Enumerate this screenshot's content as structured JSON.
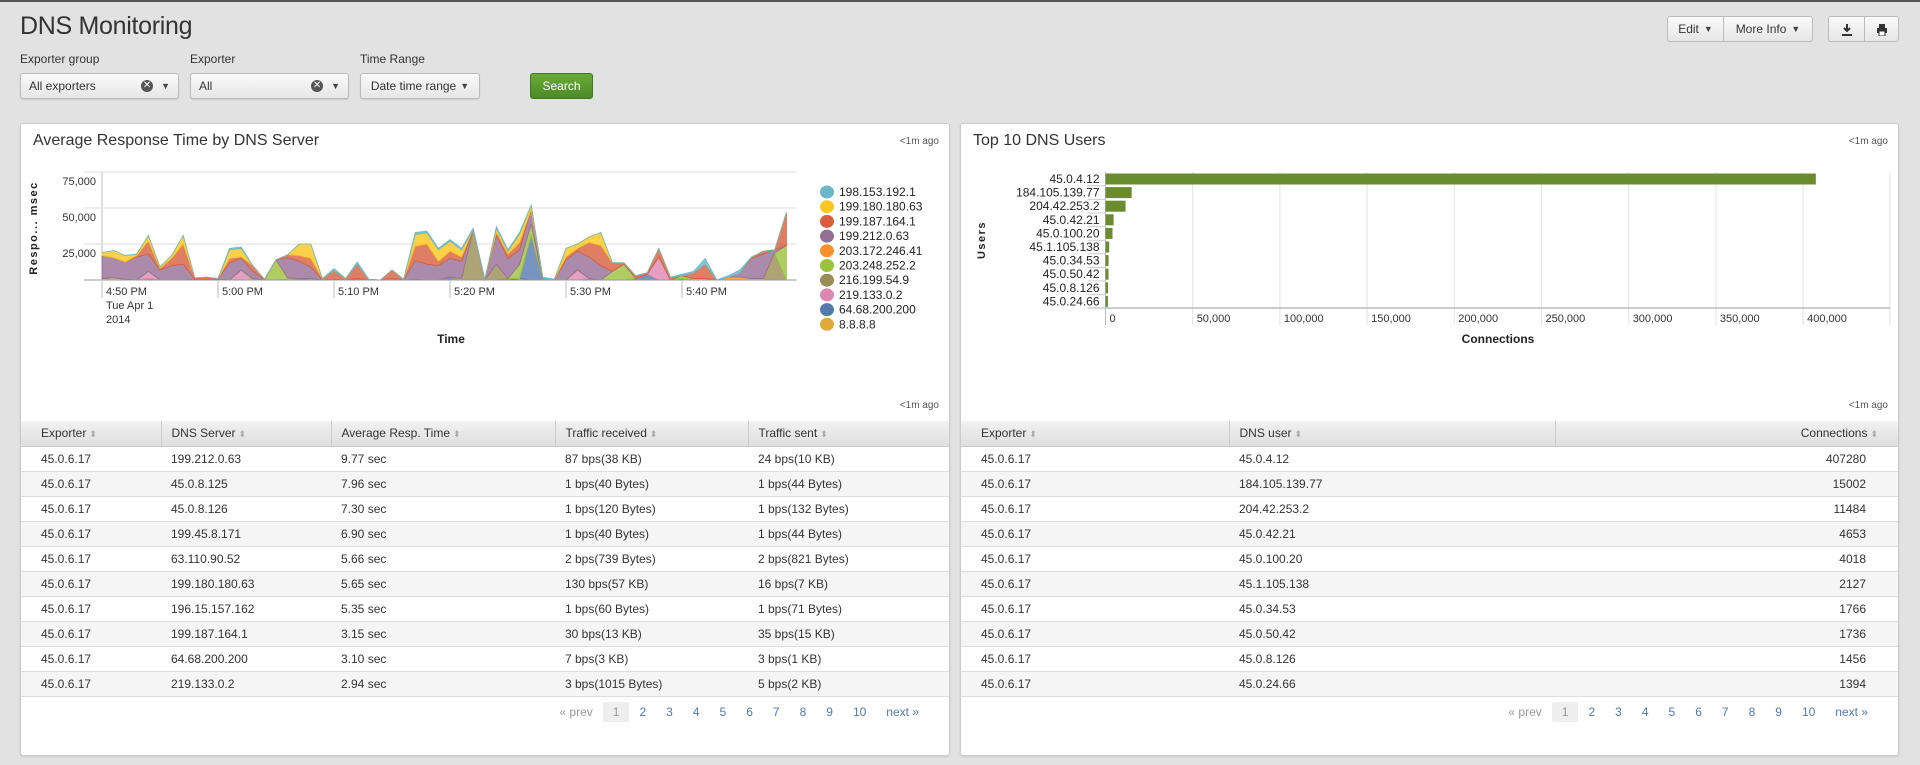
{
  "header": {
    "title": "DNS Monitoring",
    "edit_label": "Edit",
    "more_info_label": "More Info",
    "download_icon": "download-icon",
    "print_icon": "print-icon"
  },
  "filters": {
    "exporter_group": {
      "label": "Exporter group",
      "value": "All exporters"
    },
    "exporter": {
      "label": "Exporter",
      "value": "All"
    },
    "time_range": {
      "label": "Time Range",
      "value": "Date time range"
    },
    "search_label": "Search"
  },
  "left_panel": {
    "title": "Average Response Time by DNS Server",
    "updated": "<1m ago",
    "table_updated": "<1m ago",
    "columns": [
      "Exporter",
      "DNS Server",
      "Average Resp. Time",
      "Traffic received",
      "Traffic sent"
    ],
    "rows": [
      [
        "45.0.6.17",
        "199.212.0.63",
        "9.77 sec",
        "87 bps(38 KB)",
        "24 bps(10 KB)"
      ],
      [
        "45.0.6.17",
        "45.0.8.125",
        "7.96 sec",
        "1 bps(40 Bytes)",
        "1 bps(44 Bytes)"
      ],
      [
        "45.0.6.17",
        "45.0.8.126",
        "7.30 sec",
        "1 bps(120 Bytes)",
        "1 bps(132 Bytes)"
      ],
      [
        "45.0.6.17",
        "199.45.8.171",
        "6.90 sec",
        "1 bps(40 Bytes)",
        "1 bps(44 Bytes)"
      ],
      [
        "45.0.6.17",
        "63.110.90.52",
        "5.66 sec",
        "2 bps(739 Bytes)",
        "2 bps(821 Bytes)"
      ],
      [
        "45.0.6.17",
        "199.180.180.63",
        "5.65 sec",
        "130 bps(57 KB)",
        "16 bps(7 KB)"
      ],
      [
        "45.0.6.17",
        "196.15.157.162",
        "5.35 sec",
        "1 bps(60 Bytes)",
        "1 bps(71 Bytes)"
      ],
      [
        "45.0.6.17",
        "199.187.164.1",
        "3.15 sec",
        "30 bps(13 KB)",
        "35 bps(15 KB)"
      ],
      [
        "45.0.6.17",
        "64.68.200.200",
        "3.10 sec",
        "7 bps(3 KB)",
        "3 bps(1 KB)"
      ],
      [
        "45.0.6.17",
        "219.133.0.2",
        "2.94 sec",
        "3 bps(1015 Bytes)",
        "5 bps(2 KB)"
      ]
    ],
    "pager": {
      "prev": "« prev",
      "pages": [
        "1",
        "2",
        "3",
        "4",
        "5",
        "6",
        "7",
        "8",
        "9",
        "10"
      ],
      "current": "1",
      "next": "next »"
    }
  },
  "right_panel": {
    "title": "Top 10 DNS Users",
    "updated": "<1m ago",
    "table_updated": "<1m ago",
    "columns": [
      "Exporter",
      "DNS user",
      "Connections"
    ],
    "rows": [
      [
        "45.0.6.17",
        "45.0.4.12",
        "407280"
      ],
      [
        "45.0.6.17",
        "184.105.139.77",
        "15002"
      ],
      [
        "45.0.6.17",
        "204.42.253.2",
        "11484"
      ],
      [
        "45.0.6.17",
        "45.0.42.21",
        "4653"
      ],
      [
        "45.0.6.17",
        "45.0.100.20",
        "4018"
      ],
      [
        "45.0.6.17",
        "45.1.105.138",
        "2127"
      ],
      [
        "45.0.6.17",
        "45.0.34.53",
        "1766"
      ],
      [
        "45.0.6.17",
        "45.0.50.42",
        "1736"
      ],
      [
        "45.0.6.17",
        "45.0.8.126",
        "1456"
      ],
      [
        "45.0.6.17",
        "45.0.24.66",
        "1394"
      ]
    ],
    "pager": {
      "prev": "« prev",
      "pages": [
        "1",
        "2",
        "3",
        "4",
        "5",
        "6",
        "7",
        "8",
        "9",
        "10"
      ],
      "current": "1",
      "next": "next »"
    }
  },
  "chart_data": [
    {
      "type": "area",
      "stacked": true,
      "xlabel": "Time",
      "ylabel": "Respo... msec",
      "ylim": [
        0,
        75000
      ],
      "yticks": [
        "25,000",
        "50,000",
        "75,000"
      ],
      "ytick_values": [
        25000,
        50000,
        75000
      ],
      "xticks": [
        "4:50 PM",
        "5:00 PM",
        "5:10 PM",
        "5:20 PM",
        "5:30 PM",
        "5:40 PM"
      ],
      "xtick_minutes": [
        0,
        10,
        20,
        30,
        40,
        50
      ],
      "xtick_sublabel": [
        "Tue Apr 1",
        "2014"
      ],
      "x": [
        "4:50 PM",
        "4:51 PM",
        "4:52 PM",
        "4:53 PM",
        "4:54 PM",
        "4:55 PM",
        "4:56 PM",
        "4:57 PM",
        "4:58 PM",
        "4:59 PM",
        "5:00 PM",
        "5:01 PM",
        "5:02 PM",
        "5:03 PM",
        "5:04 PM",
        "5:05 PM",
        "5:06 PM",
        "5:07 PM",
        "5:08 PM",
        "5:09 PM",
        "5:10 PM",
        "5:11 PM",
        "5:12 PM",
        "5:13 PM",
        "5:14 PM",
        "5:15 PM",
        "5:16 PM",
        "5:17 PM",
        "5:18 PM",
        "5:19 PM",
        "5:20 PM",
        "5:21 PM",
        "5:22 PM",
        "5:23 PM",
        "5:24 PM",
        "5:25 PM",
        "5:26 PM",
        "5:27 PM",
        "5:28 PM",
        "5:29 PM",
        "5:30 PM",
        "5:31 PM",
        "5:32 PM",
        "5:33 PM",
        "5:34 PM",
        "5:35 PM",
        "5:36 PM",
        "5:37 PM",
        "5:38 PM",
        "5:39 PM",
        "5:40 PM",
        "5:41 PM",
        "5:42 PM",
        "5:43 PM",
        "5:44 PM",
        "5:45 PM",
        "5:46 PM",
        "5:47 PM",
        "5:48 PM",
        "5:49 PM"
      ],
      "grid": true,
      "legend": "right",
      "series": [
        {
          "name": "198.153.192.1",
          "color": "#6ab7c7",
          "values": [
            0,
            0,
            0,
            0,
            0,
            0,
            0,
            0,
            0,
            0,
            0,
            1000,
            1000,
            0,
            0,
            0,
            0,
            0,
            0,
            0,
            1500,
            0,
            1500,
            0,
            0,
            0,
            0,
            1500,
            1000,
            1000,
            1000,
            1000,
            1000,
            0,
            1000,
            1000,
            1000,
            0,
            1000,
            0,
            0,
            0,
            0,
            0,
            0,
            0,
            0,
            0,
            0,
            0,
            1000,
            1000,
            4000,
            0,
            1000,
            2000,
            0,
            0,
            0,
            0
          ]
        },
        {
          "name": "199.180.180.63",
          "color": "#fac61d",
          "values": [
            2000,
            5000,
            4500,
            1000,
            4000,
            1000,
            2000,
            6000,
            0,
            0,
            0,
            6000,
            6000,
            0,
            0,
            0,
            0,
            8000,
            10000,
            0,
            0,
            0,
            0,
            0,
            0,
            0,
            0,
            8000,
            8000,
            8000,
            7000,
            5000,
            0,
            0,
            3000,
            2000,
            6000,
            3000,
            0,
            0,
            6000,
            3000,
            4000,
            9000,
            0,
            0,
            0,
            0,
            0,
            0,
            0,
            0,
            0,
            0,
            0,
            0,
            0,
            0,
            0,
            0
          ]
        },
        {
          "name": "199.187.164.1",
          "color": "#d85e3d",
          "values": [
            0,
            0,
            0,
            1000,
            9000,
            1000,
            5000,
            14000,
            1000,
            1500,
            500,
            3000,
            1000,
            4000,
            500,
            0,
            2000,
            4000,
            6000,
            1000,
            6000,
            1000,
            10000,
            500,
            0,
            6000,
            500,
            10000,
            14000,
            3000,
            5000,
            3000,
            0,
            500,
            2000,
            3000,
            5000,
            0,
            1000,
            500,
            2000,
            2000,
            10000,
            14000,
            6000,
            1000,
            2000,
            1000,
            6000,
            2000,
            0,
            4000,
            10000,
            0,
            0,
            0,
            1000,
            2000,
            0,
            23000
          ]
        },
        {
          "name": "199.212.0.63",
          "color": "#956e96",
          "values": [
            16000,
            14000,
            12000,
            16000,
            12000,
            7000,
            10000,
            11000,
            0,
            0,
            0,
            12000,
            8000,
            5000,
            0,
            0,
            14000,
            12000,
            8000,
            0,
            0,
            0,
            0,
            0,
            0,
            0,
            0,
            13000,
            11000,
            10000,
            13000,
            12000,
            0,
            0,
            20000,
            14000,
            10000,
            10000,
            0,
            0,
            14000,
            13000,
            15000,
            10000,
            0,
            0,
            0,
            0,
            0,
            0,
            0,
            0,
            0,
            0,
            0,
            3000,
            14000,
            17000,
            2000,
            0
          ]
        },
        {
          "name": "203.172.246.41",
          "color": "#f7912c",
          "values": [
            0,
            0,
            0,
            0,
            0,
            0,
            0,
            0,
            0,
            0,
            0,
            0,
            0,
            0,
            0,
            0,
            0,
            0,
            0,
            0,
            0,
            0,
            0,
            0,
            0,
            0,
            0,
            0,
            0,
            0,
            0,
            0,
            0,
            0,
            0,
            0,
            0,
            0,
            0,
            0,
            0,
            0,
            0,
            0,
            0,
            0,
            0,
            0,
            0,
            0,
            0,
            0,
            0,
            0,
            2000,
            2000,
            1000,
            1000,
            0,
            0
          ]
        },
        {
          "name": "203.248.252.2",
          "color": "#9ac23c",
          "values": [
            0,
            0,
            0,
            0,
            0,
            0,
            0,
            0,
            0,
            0,
            0,
            0,
            0,
            1000,
            0,
            14000,
            1000,
            0,
            0,
            0,
            0,
            0,
            0,
            0,
            0,
            1000,
            0,
            500,
            0,
            0,
            0,
            1000,
            0,
            0,
            0,
            0,
            10000,
            8000,
            0,
            0,
            0,
            0,
            0,
            0,
            6000,
            11000,
            0,
            0,
            0,
            0,
            2000,
            1000,
            1000,
            0,
            0,
            0,
            0,
            0,
            1000,
            24000
          ]
        },
        {
          "name": "216.199.54.9",
          "color": "#998c55",
          "values": [
            0,
            0,
            0,
            0,
            0,
            0,
            0,
            0,
            0,
            0,
            0,
            0,
            0,
            0,
            0,
            0,
            0,
            0,
            1000,
            0,
            0,
            0,
            0,
            0,
            0,
            0,
            0,
            0,
            0,
            0,
            0,
            0,
            35000,
            0,
            11000,
            0,
            0,
            0,
            0,
            0,
            0,
            0,
            0,
            0,
            0,
            0,
            0,
            0,
            0,
            0,
            0,
            0,
            0,
            0,
            0,
            0,
            0,
            0,
            18000,
            0
          ]
        },
        {
          "name": "219.133.0.2",
          "color": "#dd87b3",
          "values": [
            0,
            0,
            0,
            0,
            5000,
            0,
            0,
            0,
            0,
            0,
            0,
            0,
            7000,
            0,
            0,
            0,
            0,
            0,
            0,
            0,
            0,
            0,
            0,
            0,
            0,
            0,
            0,
            0,
            0,
            0,
            0,
            0,
            0,
            0,
            0,
            0,
            0,
            0,
            0,
            0,
            0,
            7000,
            0,
            0,
            0,
            0,
            0,
            0,
            16000,
            0,
            0,
            0,
            0,
            0,
            0,
            0,
            0,
            0,
            0,
            0
          ]
        },
        {
          "name": "64.68.200.200",
          "color": "#5479af",
          "values": [
            0,
            0,
            0,
            0,
            0,
            0,
            0,
            0,
            0,
            0,
            0,
            0,
            0,
            0,
            0,
            0,
            500,
            1000,
            0,
            0,
            500,
            0,
            1000,
            0,
            0,
            0,
            0,
            0,
            0,
            0,
            2000,
            0,
            0,
            0,
            0,
            1000,
            0,
            31000,
            0,
            0,
            0,
            0,
            1000,
            0,
            0,
            0,
            1000,
            4000,
            0,
            0,
            1000,
            0,
            0,
            0,
            0,
            0,
            0,
            0,
            0,
            0
          ]
        },
        {
          "name": "8.8.8.8",
          "color": "#e0a93b",
          "values": [
            1000,
            1500,
            500,
            0,
            1000,
            0,
            0,
            0,
            500,
            500,
            500,
            0,
            0,
            0,
            0,
            0,
            0,
            0,
            0,
            0,
            0,
            0,
            0,
            0,
            0,
            0,
            0,
            0,
            0,
            0,
            0,
            0,
            0,
            0,
            0,
            0,
            1000,
            0,
            0,
            0,
            0,
            0,
            0,
            0,
            0,
            0,
            0,
            0,
            0,
            0,
            0,
            0,
            0,
            0,
            0,
            0,
            0,
            0,
            0,
            0
          ]
        }
      ]
    },
    {
      "type": "bar",
      "orientation": "horizontal",
      "xlabel": "Connections",
      "ylabel": "Users",
      "xlim": [
        0,
        450000
      ],
      "xticks": [
        "0",
        "50,000",
        "100,000",
        "150,000",
        "200,000",
        "250,000",
        "300,000",
        "350,000",
        "400,000"
      ],
      "xtick_values": [
        0,
        50000,
        100000,
        150000,
        200000,
        250000,
        300000,
        350000,
        400000
      ],
      "categories": [
        "45.0.4.12",
        "184.105.139.77",
        "204.42.253.2",
        "45.0.42.21",
        "45.0.100.20",
        "45.1.105.138",
        "45.0.34.53",
        "45.0.50.42",
        "45.0.8.126",
        "45.0.24.66"
      ],
      "values": [
        407280,
        15002,
        11484,
        4653,
        4018,
        2127,
        1766,
        1736,
        1456,
        1394
      ],
      "color": "#6a8c2f",
      "grid": true
    }
  ]
}
